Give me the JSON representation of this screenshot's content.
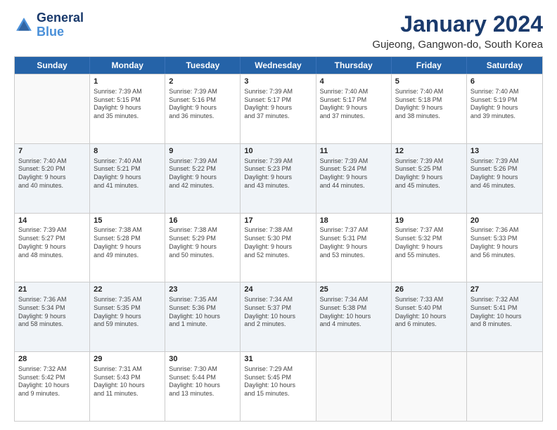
{
  "logo": {
    "line1": "General",
    "line2": "Blue"
  },
  "title": "January 2024",
  "location": "Gujeong, Gangwon-do, South Korea",
  "header_days": [
    "Sunday",
    "Monday",
    "Tuesday",
    "Wednesday",
    "Thursday",
    "Friday",
    "Saturday"
  ],
  "weeks": [
    [
      {
        "day": "",
        "info": "",
        "shaded": false,
        "empty": true
      },
      {
        "day": "1",
        "info": "Sunrise: 7:39 AM\nSunset: 5:15 PM\nDaylight: 9 hours\nand 35 minutes.",
        "shaded": false,
        "empty": false
      },
      {
        "day": "2",
        "info": "Sunrise: 7:39 AM\nSunset: 5:16 PM\nDaylight: 9 hours\nand 36 minutes.",
        "shaded": false,
        "empty": false
      },
      {
        "day": "3",
        "info": "Sunrise: 7:39 AM\nSunset: 5:17 PM\nDaylight: 9 hours\nand 37 minutes.",
        "shaded": false,
        "empty": false
      },
      {
        "day": "4",
        "info": "Sunrise: 7:40 AM\nSunset: 5:17 PM\nDaylight: 9 hours\nand 37 minutes.",
        "shaded": false,
        "empty": false
      },
      {
        "day": "5",
        "info": "Sunrise: 7:40 AM\nSunset: 5:18 PM\nDaylight: 9 hours\nand 38 minutes.",
        "shaded": false,
        "empty": false
      },
      {
        "day": "6",
        "info": "Sunrise: 7:40 AM\nSunset: 5:19 PM\nDaylight: 9 hours\nand 39 minutes.",
        "shaded": false,
        "empty": false
      }
    ],
    [
      {
        "day": "7",
        "info": "Sunrise: 7:40 AM\nSunset: 5:20 PM\nDaylight: 9 hours\nand 40 minutes.",
        "shaded": true,
        "empty": false
      },
      {
        "day": "8",
        "info": "Sunrise: 7:40 AM\nSunset: 5:21 PM\nDaylight: 9 hours\nand 41 minutes.",
        "shaded": true,
        "empty": false
      },
      {
        "day": "9",
        "info": "Sunrise: 7:39 AM\nSunset: 5:22 PM\nDaylight: 9 hours\nand 42 minutes.",
        "shaded": true,
        "empty": false
      },
      {
        "day": "10",
        "info": "Sunrise: 7:39 AM\nSunset: 5:23 PM\nDaylight: 9 hours\nand 43 minutes.",
        "shaded": true,
        "empty": false
      },
      {
        "day": "11",
        "info": "Sunrise: 7:39 AM\nSunset: 5:24 PM\nDaylight: 9 hours\nand 44 minutes.",
        "shaded": true,
        "empty": false
      },
      {
        "day": "12",
        "info": "Sunrise: 7:39 AM\nSunset: 5:25 PM\nDaylight: 9 hours\nand 45 minutes.",
        "shaded": true,
        "empty": false
      },
      {
        "day": "13",
        "info": "Sunrise: 7:39 AM\nSunset: 5:26 PM\nDaylight: 9 hours\nand 46 minutes.",
        "shaded": true,
        "empty": false
      }
    ],
    [
      {
        "day": "14",
        "info": "Sunrise: 7:39 AM\nSunset: 5:27 PM\nDaylight: 9 hours\nand 48 minutes.",
        "shaded": false,
        "empty": false
      },
      {
        "day": "15",
        "info": "Sunrise: 7:38 AM\nSunset: 5:28 PM\nDaylight: 9 hours\nand 49 minutes.",
        "shaded": false,
        "empty": false
      },
      {
        "day": "16",
        "info": "Sunrise: 7:38 AM\nSunset: 5:29 PM\nDaylight: 9 hours\nand 50 minutes.",
        "shaded": false,
        "empty": false
      },
      {
        "day": "17",
        "info": "Sunrise: 7:38 AM\nSunset: 5:30 PM\nDaylight: 9 hours\nand 52 minutes.",
        "shaded": false,
        "empty": false
      },
      {
        "day": "18",
        "info": "Sunrise: 7:37 AM\nSunset: 5:31 PM\nDaylight: 9 hours\nand 53 minutes.",
        "shaded": false,
        "empty": false
      },
      {
        "day": "19",
        "info": "Sunrise: 7:37 AM\nSunset: 5:32 PM\nDaylight: 9 hours\nand 55 minutes.",
        "shaded": false,
        "empty": false
      },
      {
        "day": "20",
        "info": "Sunrise: 7:36 AM\nSunset: 5:33 PM\nDaylight: 9 hours\nand 56 minutes.",
        "shaded": false,
        "empty": false
      }
    ],
    [
      {
        "day": "21",
        "info": "Sunrise: 7:36 AM\nSunset: 5:34 PM\nDaylight: 9 hours\nand 58 minutes.",
        "shaded": true,
        "empty": false
      },
      {
        "day": "22",
        "info": "Sunrise: 7:35 AM\nSunset: 5:35 PM\nDaylight: 9 hours\nand 59 minutes.",
        "shaded": true,
        "empty": false
      },
      {
        "day": "23",
        "info": "Sunrise: 7:35 AM\nSunset: 5:36 PM\nDaylight: 10 hours\nand 1 minute.",
        "shaded": true,
        "empty": false
      },
      {
        "day": "24",
        "info": "Sunrise: 7:34 AM\nSunset: 5:37 PM\nDaylight: 10 hours\nand 2 minutes.",
        "shaded": true,
        "empty": false
      },
      {
        "day": "25",
        "info": "Sunrise: 7:34 AM\nSunset: 5:38 PM\nDaylight: 10 hours\nand 4 minutes.",
        "shaded": true,
        "empty": false
      },
      {
        "day": "26",
        "info": "Sunrise: 7:33 AM\nSunset: 5:40 PM\nDaylight: 10 hours\nand 6 minutes.",
        "shaded": true,
        "empty": false
      },
      {
        "day": "27",
        "info": "Sunrise: 7:32 AM\nSunset: 5:41 PM\nDaylight: 10 hours\nand 8 minutes.",
        "shaded": true,
        "empty": false
      }
    ],
    [
      {
        "day": "28",
        "info": "Sunrise: 7:32 AM\nSunset: 5:42 PM\nDaylight: 10 hours\nand 9 minutes.",
        "shaded": false,
        "empty": false
      },
      {
        "day": "29",
        "info": "Sunrise: 7:31 AM\nSunset: 5:43 PM\nDaylight: 10 hours\nand 11 minutes.",
        "shaded": false,
        "empty": false
      },
      {
        "day": "30",
        "info": "Sunrise: 7:30 AM\nSunset: 5:44 PM\nDaylight: 10 hours\nand 13 minutes.",
        "shaded": false,
        "empty": false
      },
      {
        "day": "31",
        "info": "Sunrise: 7:29 AM\nSunset: 5:45 PM\nDaylight: 10 hours\nand 15 minutes.",
        "shaded": false,
        "empty": false
      },
      {
        "day": "",
        "info": "",
        "shaded": false,
        "empty": true
      },
      {
        "day": "",
        "info": "",
        "shaded": false,
        "empty": true
      },
      {
        "day": "",
        "info": "",
        "shaded": false,
        "empty": true
      }
    ]
  ]
}
